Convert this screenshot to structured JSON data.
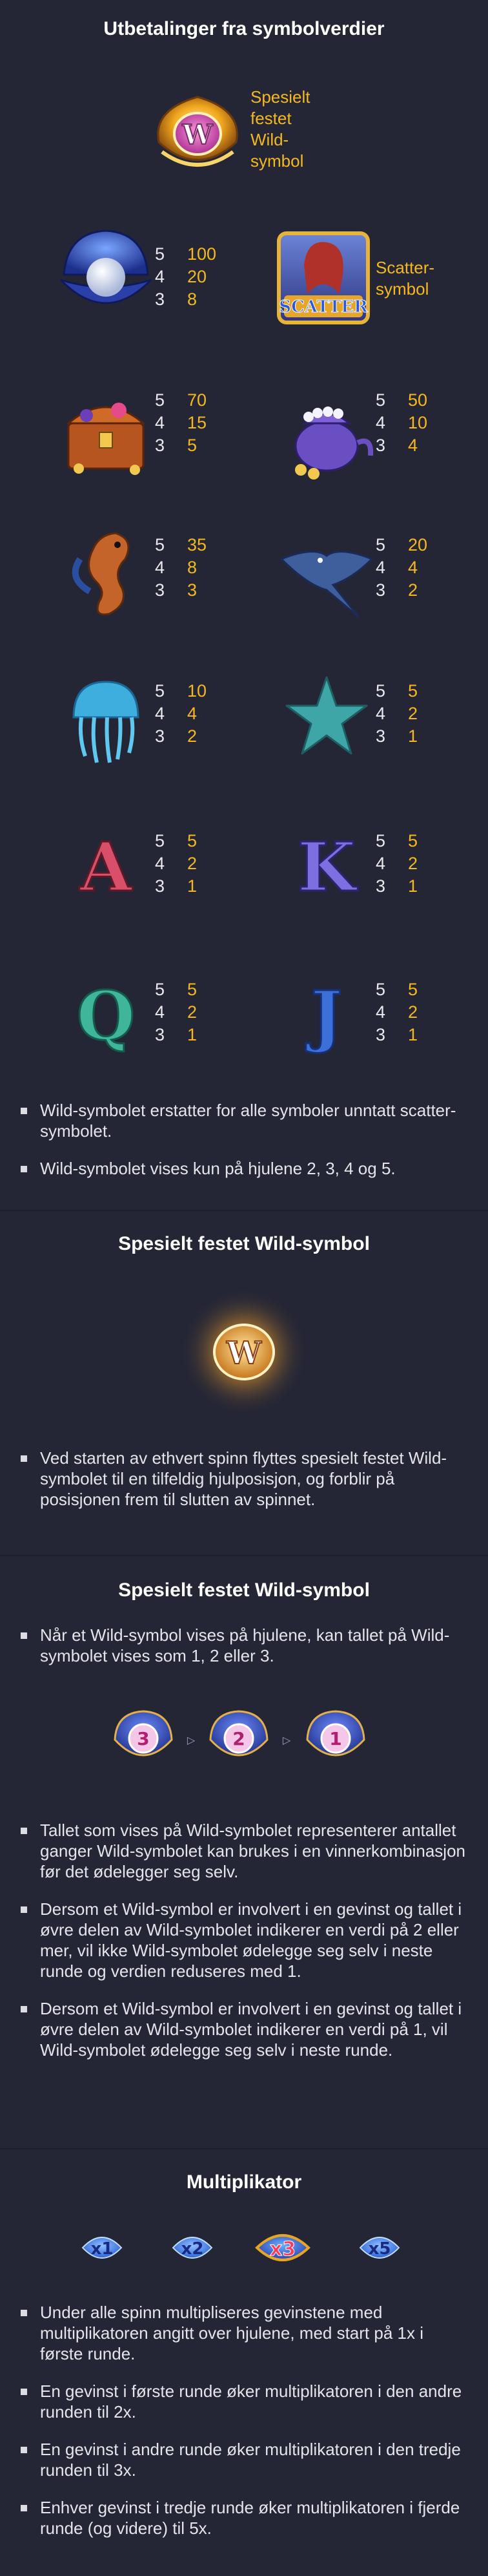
{
  "sections": {
    "payouts": {
      "title": "Utbetalinger fra symbolverdier",
      "special_wild_label": "Spesielt festet Wild-symbol",
      "scatter_label": "Scatter-symbol",
      "symbols": [
        {
          "name": "pearl-shell",
          "pays": [
            {
              "count": "5",
              "value": "100"
            },
            {
              "count": "4",
              "value": "20"
            },
            {
              "count": "3",
              "value": "8"
            }
          ]
        },
        {
          "name": "treasure-chest",
          "pays": [
            {
              "count": "5",
              "value": "70"
            },
            {
              "count": "4",
              "value": "15"
            },
            {
              "count": "3",
              "value": "5"
            }
          ]
        },
        {
          "name": "teapot-with-pearls",
          "pays": [
            {
              "count": "5",
              "value": "50"
            },
            {
              "count": "4",
              "value": "10"
            },
            {
              "count": "3",
              "value": "4"
            }
          ]
        },
        {
          "name": "seahorse",
          "pays": [
            {
              "count": "5",
              "value": "35"
            },
            {
              "count": "4",
              "value": "8"
            },
            {
              "count": "3",
              "value": "3"
            }
          ]
        },
        {
          "name": "manta-ray",
          "pays": [
            {
              "count": "5",
              "value": "20"
            },
            {
              "count": "4",
              "value": "4"
            },
            {
              "count": "3",
              "value": "2"
            }
          ]
        },
        {
          "name": "jellyfish",
          "pays": [
            {
              "count": "5",
              "value": "10"
            },
            {
              "count": "4",
              "value": "4"
            },
            {
              "count": "3",
              "value": "2"
            }
          ]
        },
        {
          "name": "starfish",
          "pays": [
            {
              "count": "5",
              "value": "5"
            },
            {
              "count": "4",
              "value": "2"
            },
            {
              "count": "3",
              "value": "1"
            }
          ]
        },
        {
          "name": "letter-a",
          "letter": "A",
          "pays": [
            {
              "count": "5",
              "value": "5"
            },
            {
              "count": "4",
              "value": "2"
            },
            {
              "count": "3",
              "value": "1"
            }
          ]
        },
        {
          "name": "letter-k",
          "letter": "K",
          "pays": [
            {
              "count": "5",
              "value": "5"
            },
            {
              "count": "4",
              "value": "2"
            },
            {
              "count": "3",
              "value": "1"
            }
          ]
        },
        {
          "name": "letter-q",
          "letter": "Q",
          "pays": [
            {
              "count": "5",
              "value": "5"
            },
            {
              "count": "4",
              "value": "2"
            },
            {
              "count": "3",
              "value": "1"
            }
          ]
        },
        {
          "name": "letter-j",
          "letter": "J",
          "pays": [
            {
              "count": "5",
              "value": "5"
            },
            {
              "count": "4",
              "value": "2"
            },
            {
              "count": "3",
              "value": "1"
            }
          ]
        }
      ],
      "bullets": [
        "Wild-symbolet erstatter for alle symboler unntatt scatter-symbolet.",
        "Wild-symbolet vises kun på hjulene 2, 3, 4 og 5."
      ]
    },
    "special_wild": {
      "title": "Spesielt festet Wild-symbol",
      "bullets": [
        "Ved starten av ethvert spinn flyttes spesielt festet Wild-symbolet til en tilfeldig hjulposisjon, og forblir på posisjonen frem til slutten av spinnet."
      ]
    },
    "special_wild_counter": {
      "title": "Spesielt festet Wild-symbol",
      "intro": "Når et Wild-symbol vises på hjulene, kan tallet på Wild-symbolet vises som 1, 2 eller 3.",
      "counter_numbers": [
        "3",
        "2",
        "1"
      ],
      "bullets": [
        "Tallet som vises på Wild-symbolet representerer antallet ganger Wild-symbolet kan brukes i en vinnerkombinasjon før det ødelegger seg selv.",
        "Dersom et Wild-symbol er involvert i en gevinst og tallet i øvre delen av Wild-symbolet indikerer en verdi på 2 eller mer, vil ikke Wild-symbolet ødelegge seg selv i neste runde og verdien reduseres med 1.",
        "Dersom et Wild-symbol er involvert i en gevinst og tallet i øvre delen av Wild-symbolet indikerer en verdi på 1, vil Wild-symbolet ødelegge seg selv i neste runde."
      ]
    },
    "multiplier": {
      "title": "Multiplikator",
      "badges": [
        "x1",
        "x2",
        "x3",
        "x5"
      ],
      "bullets": [
        "Under alle spinn multipliseres gevinstene med multiplikatoren angitt over hjulene, med start på 1x i første runde.",
        "En gevinst i første runde øker multiplikatoren i den andre runden til 2x.",
        "En gevinst i andre runde øker multiplikatoren i den tredje runden til 3x.",
        "Enhver gevinst i tredje runde øker multiplikatoren i fjerde runde (og videre) til 5x."
      ]
    }
  },
  "colors": {
    "background": "#252635",
    "divider": "#1e1f2c",
    "accent_gold": "#f5b81c",
    "text": "#e4e4ea"
  },
  "icons": {
    "wild": "W-shell-icon",
    "scatter": "mermaid-scatter-icon"
  }
}
